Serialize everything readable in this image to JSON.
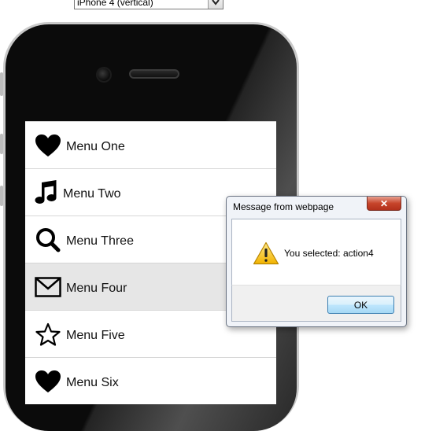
{
  "device_select": {
    "value": "iPhone 4 (vertical)"
  },
  "menu": {
    "items": [
      {
        "label": "Menu One",
        "icon": "heart-icon"
      },
      {
        "label": "Menu Two",
        "icon": "music-note-icon"
      },
      {
        "label": "Menu Three",
        "icon": "search-icon"
      },
      {
        "label": "Menu Four",
        "icon": "envelope-icon",
        "selected": true
      },
      {
        "label": "Menu Five",
        "icon": "star-icon"
      },
      {
        "label": "Menu Six",
        "icon": "heart-icon"
      }
    ]
  },
  "dialog": {
    "title": "Message from webpage",
    "close_label": "✕",
    "message": "You selected: action4",
    "ok_label": "OK",
    "icon": "warning-icon"
  },
  "colors": {
    "selected_row": "#e6e6e6",
    "dialog_close": "#c7452b",
    "ok_border": "#3c7fb1"
  }
}
